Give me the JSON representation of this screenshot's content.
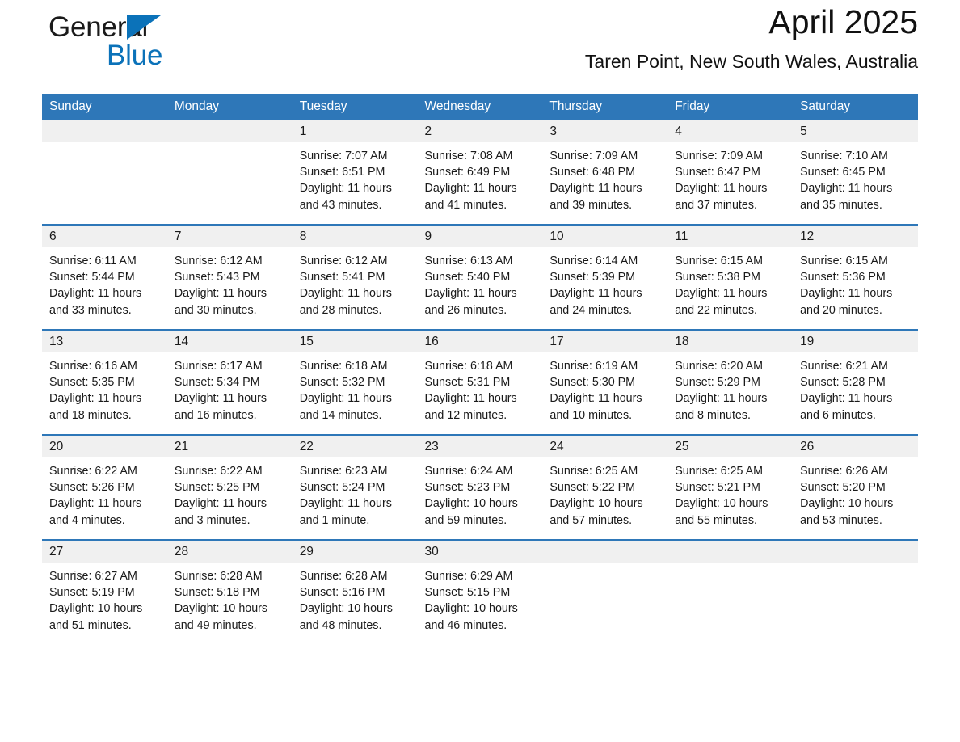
{
  "brand": {
    "name_part1": "General",
    "name_part2": "Blue",
    "triangle_color": "#0b72b9",
    "text_color": "#1a1a1a"
  },
  "header": {
    "title": "April 2025",
    "subtitle": "Taren Point, New South Wales, Australia",
    "accent_color": "#2e77b8",
    "daynum_band_color": "#f0f0f0"
  },
  "weekday_headers": [
    "Sunday",
    "Monday",
    "Tuesday",
    "Wednesday",
    "Thursday",
    "Friday",
    "Saturday"
  ],
  "weeks": [
    [
      {
        "day": "",
        "sunrise": "",
        "sunset": "",
        "daylight_line1": "",
        "daylight_line2": ""
      },
      {
        "day": "",
        "sunrise": "",
        "sunset": "",
        "daylight_line1": "",
        "daylight_line2": ""
      },
      {
        "day": "1",
        "sunrise": "Sunrise: 7:07 AM",
        "sunset": "Sunset: 6:51 PM",
        "daylight_line1": "Daylight: 11 hours",
        "daylight_line2": "and 43 minutes."
      },
      {
        "day": "2",
        "sunrise": "Sunrise: 7:08 AM",
        "sunset": "Sunset: 6:49 PM",
        "daylight_line1": "Daylight: 11 hours",
        "daylight_line2": "and 41 minutes."
      },
      {
        "day": "3",
        "sunrise": "Sunrise: 7:09 AM",
        "sunset": "Sunset: 6:48 PM",
        "daylight_line1": "Daylight: 11 hours",
        "daylight_line2": "and 39 minutes."
      },
      {
        "day": "4",
        "sunrise": "Sunrise: 7:09 AM",
        "sunset": "Sunset: 6:47 PM",
        "daylight_line1": "Daylight: 11 hours",
        "daylight_line2": "and 37 minutes."
      },
      {
        "day": "5",
        "sunrise": "Sunrise: 7:10 AM",
        "sunset": "Sunset: 6:45 PM",
        "daylight_line1": "Daylight: 11 hours",
        "daylight_line2": "and 35 minutes."
      }
    ],
    [
      {
        "day": "6",
        "sunrise": "Sunrise: 6:11 AM",
        "sunset": "Sunset: 5:44 PM",
        "daylight_line1": "Daylight: 11 hours",
        "daylight_line2": "and 33 minutes."
      },
      {
        "day": "7",
        "sunrise": "Sunrise: 6:12 AM",
        "sunset": "Sunset: 5:43 PM",
        "daylight_line1": "Daylight: 11 hours",
        "daylight_line2": "and 30 minutes."
      },
      {
        "day": "8",
        "sunrise": "Sunrise: 6:12 AM",
        "sunset": "Sunset: 5:41 PM",
        "daylight_line1": "Daylight: 11 hours",
        "daylight_line2": "and 28 minutes."
      },
      {
        "day": "9",
        "sunrise": "Sunrise: 6:13 AM",
        "sunset": "Sunset: 5:40 PM",
        "daylight_line1": "Daylight: 11 hours",
        "daylight_line2": "and 26 minutes."
      },
      {
        "day": "10",
        "sunrise": "Sunrise: 6:14 AM",
        "sunset": "Sunset: 5:39 PM",
        "daylight_line1": "Daylight: 11 hours",
        "daylight_line2": "and 24 minutes."
      },
      {
        "day": "11",
        "sunrise": "Sunrise: 6:15 AM",
        "sunset": "Sunset: 5:38 PM",
        "daylight_line1": "Daylight: 11 hours",
        "daylight_line2": "and 22 minutes."
      },
      {
        "day": "12",
        "sunrise": "Sunrise: 6:15 AM",
        "sunset": "Sunset: 5:36 PM",
        "daylight_line1": "Daylight: 11 hours",
        "daylight_line2": "and 20 minutes."
      }
    ],
    [
      {
        "day": "13",
        "sunrise": "Sunrise: 6:16 AM",
        "sunset": "Sunset: 5:35 PM",
        "daylight_line1": "Daylight: 11 hours",
        "daylight_line2": "and 18 minutes."
      },
      {
        "day": "14",
        "sunrise": "Sunrise: 6:17 AM",
        "sunset": "Sunset: 5:34 PM",
        "daylight_line1": "Daylight: 11 hours",
        "daylight_line2": "and 16 minutes."
      },
      {
        "day": "15",
        "sunrise": "Sunrise: 6:18 AM",
        "sunset": "Sunset: 5:32 PM",
        "daylight_line1": "Daylight: 11 hours",
        "daylight_line2": "and 14 minutes."
      },
      {
        "day": "16",
        "sunrise": "Sunrise: 6:18 AM",
        "sunset": "Sunset: 5:31 PM",
        "daylight_line1": "Daylight: 11 hours",
        "daylight_line2": "and 12 minutes."
      },
      {
        "day": "17",
        "sunrise": "Sunrise: 6:19 AM",
        "sunset": "Sunset: 5:30 PM",
        "daylight_line1": "Daylight: 11 hours",
        "daylight_line2": "and 10 minutes."
      },
      {
        "day": "18",
        "sunrise": "Sunrise: 6:20 AM",
        "sunset": "Sunset: 5:29 PM",
        "daylight_line1": "Daylight: 11 hours",
        "daylight_line2": "and 8 minutes."
      },
      {
        "day": "19",
        "sunrise": "Sunrise: 6:21 AM",
        "sunset": "Sunset: 5:28 PM",
        "daylight_line1": "Daylight: 11 hours",
        "daylight_line2": "and 6 minutes."
      }
    ],
    [
      {
        "day": "20",
        "sunrise": "Sunrise: 6:22 AM",
        "sunset": "Sunset: 5:26 PM",
        "daylight_line1": "Daylight: 11 hours",
        "daylight_line2": "and 4 minutes."
      },
      {
        "day": "21",
        "sunrise": "Sunrise: 6:22 AM",
        "sunset": "Sunset: 5:25 PM",
        "daylight_line1": "Daylight: 11 hours",
        "daylight_line2": "and 3 minutes."
      },
      {
        "day": "22",
        "sunrise": "Sunrise: 6:23 AM",
        "sunset": "Sunset: 5:24 PM",
        "daylight_line1": "Daylight: 11 hours",
        "daylight_line2": "and 1 minute."
      },
      {
        "day": "23",
        "sunrise": "Sunrise: 6:24 AM",
        "sunset": "Sunset: 5:23 PM",
        "daylight_line1": "Daylight: 10 hours",
        "daylight_line2": "and 59 minutes."
      },
      {
        "day": "24",
        "sunrise": "Sunrise: 6:25 AM",
        "sunset": "Sunset: 5:22 PM",
        "daylight_line1": "Daylight: 10 hours",
        "daylight_line2": "and 57 minutes."
      },
      {
        "day": "25",
        "sunrise": "Sunrise: 6:25 AM",
        "sunset": "Sunset: 5:21 PM",
        "daylight_line1": "Daylight: 10 hours",
        "daylight_line2": "and 55 minutes."
      },
      {
        "day": "26",
        "sunrise": "Sunrise: 6:26 AM",
        "sunset": "Sunset: 5:20 PM",
        "daylight_line1": "Daylight: 10 hours",
        "daylight_line2": "and 53 minutes."
      }
    ],
    [
      {
        "day": "27",
        "sunrise": "Sunrise: 6:27 AM",
        "sunset": "Sunset: 5:19 PM",
        "daylight_line1": "Daylight: 10 hours",
        "daylight_line2": "and 51 minutes."
      },
      {
        "day": "28",
        "sunrise": "Sunrise: 6:28 AM",
        "sunset": "Sunset: 5:18 PM",
        "daylight_line1": "Daylight: 10 hours",
        "daylight_line2": "and 49 minutes."
      },
      {
        "day": "29",
        "sunrise": "Sunrise: 6:28 AM",
        "sunset": "Sunset: 5:16 PM",
        "daylight_line1": "Daylight: 10 hours",
        "daylight_line2": "and 48 minutes."
      },
      {
        "day": "30",
        "sunrise": "Sunrise: 6:29 AM",
        "sunset": "Sunset: 5:15 PM",
        "daylight_line1": "Daylight: 10 hours",
        "daylight_line2": "and 46 minutes."
      },
      {
        "day": "",
        "sunrise": "",
        "sunset": "",
        "daylight_line1": "",
        "daylight_line2": ""
      },
      {
        "day": "",
        "sunrise": "",
        "sunset": "",
        "daylight_line1": "",
        "daylight_line2": ""
      },
      {
        "day": "",
        "sunrise": "",
        "sunset": "",
        "daylight_line1": "",
        "daylight_line2": ""
      }
    ]
  ]
}
